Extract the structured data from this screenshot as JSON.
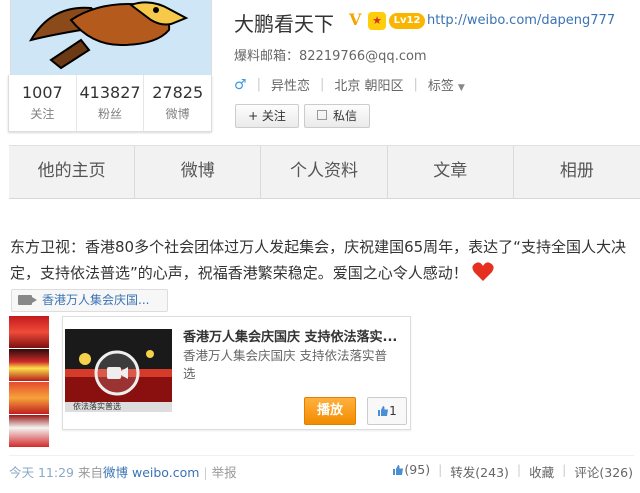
{
  "profile": {
    "name": "大鹏看天下",
    "verify_badge": "V",
    "level_badge": "Lv12",
    "url": "http://weibo.com/dapeng777",
    "email_label": "爆料邮箱：",
    "email": "82219766@qq.com",
    "gender_icon": "♂",
    "orientation": "异性恋",
    "location": "北京 朝阳区",
    "tags_label": "标签",
    "follow_label": "+ 关注",
    "message_label": "私信",
    "stats": [
      {
        "num": "1007",
        "label": "关注"
      },
      {
        "num": "413827",
        "label": "粉丝"
      },
      {
        "num": "27825",
        "label": "微博"
      }
    ]
  },
  "nav": {
    "items": [
      "他的主页",
      "微博",
      "个人资料",
      "文章",
      "相册"
    ]
  },
  "post": {
    "text": "东方卫视：香港80多个社会团体过万人发起集会，庆祝建国65周年，表达了“支持全国人大决定，支持依法普选”的心声，祝福香港繁荣稳定。爱国之心令人感动！",
    "video_link": "香港万人集会庆国...",
    "card_title": "香港万人集会庆国庆 支持依法落实...",
    "card_desc": "香港万人集会庆国庆 支持依法落实普选",
    "thumb_caption": "依法落实普选",
    "play_label": "播放",
    "card_like": "1",
    "time": "今天 11:29",
    "source_prefix": "来自",
    "source": "微博 weibo.com",
    "report": "举报",
    "likes": "(95)",
    "repost": "转发(243)",
    "favorite": "收藏",
    "comment": "评论(326)"
  },
  "colors": {
    "link": "#3a73b4",
    "accent_orange": "#f28b00",
    "nav_bg": "#f2f2f2"
  }
}
